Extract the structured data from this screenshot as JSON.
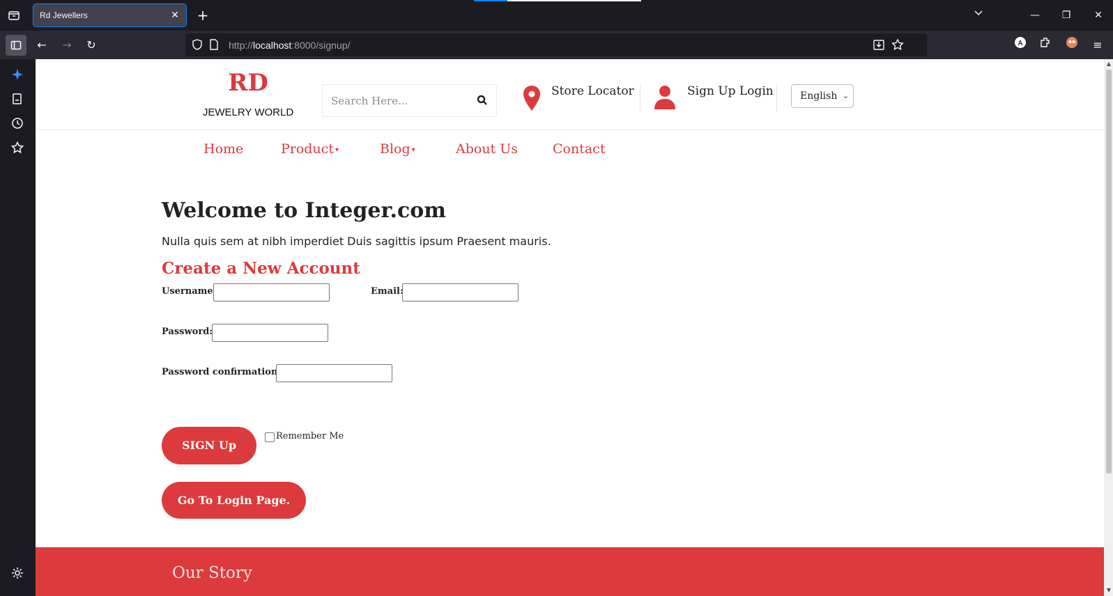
{
  "browser": {
    "tab_title": "Rd Jewellers",
    "url_scheme": "http://",
    "url_host": "localhost",
    "url_rest": ":8000/signup/",
    "accent": "#0a84ff"
  },
  "header": {
    "logo_main": "RD",
    "logo_sub": "JEWELRY WORLD",
    "search_placeholder": "Search Here...",
    "store_locator": "Store Locator",
    "signup_login": "Sign Up Login",
    "language": "English"
  },
  "menu": {
    "home": "Home",
    "product": "Product",
    "blog": "Blog",
    "about": "About Us",
    "contact": "Contact"
  },
  "main": {
    "welcome": "Welcome to Integer.com",
    "intro": "Nulla quis sem at nibh imperdiet Duis sagittis ipsum Praesent mauris.",
    "form_title": "Create a New Account",
    "username_label": "Username:",
    "email_label": "Email:",
    "password_label": "Password:",
    "password_confirm_label": "Password confirmation:",
    "signup_button": "SIGN Up",
    "remember_me": "Remember Me",
    "login_button": "Go To Login Page."
  },
  "footer": {
    "title": "Our Story"
  },
  "colors": {
    "brand": "#dc3a3c"
  }
}
